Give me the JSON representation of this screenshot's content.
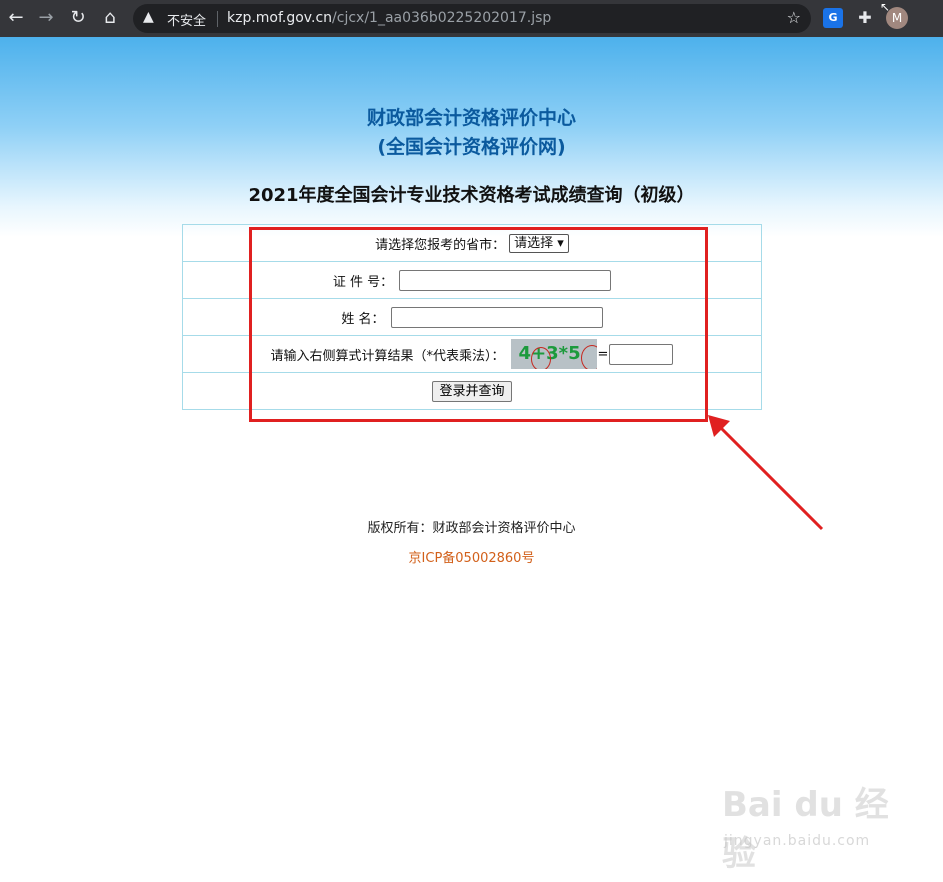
{
  "browser": {
    "back_icon": "←",
    "forward_icon": "→",
    "reload_icon": "↻",
    "home_icon": "⌂",
    "security_icon": "▲",
    "security_label": "不安全",
    "url_host": "kzp.mof.gov.cn",
    "url_path": "/cjcx/1_aa036b0225202017.jsp",
    "star_icon": "☆",
    "translate_ext": "G",
    "puzzle_icon": "✚",
    "avatar_letter": "M"
  },
  "header": {
    "site_name_line1": "财政部会计资格评价中心",
    "site_name_line2": "(全国会计资格评价网)",
    "exam_title": "2021年度全国会计专业技术资格考试成绩查询（初级）"
  },
  "form": {
    "province_label": "请选择您报考的省市：",
    "province_selected": "请选择 ▾",
    "id_label": "证 件 号：",
    "name_label": "姓  名：",
    "captcha_label": "请输入右侧算式计算结果（*代表乘法）：",
    "captcha_text": "4+3*5",
    "equals": "=",
    "submit_label": "登录并查询"
  },
  "footer": {
    "copyright": "版权所有：财政部会计资格评价中心",
    "icp": "京ICP备05002860号"
  },
  "watermark": {
    "brand": "Bai du 经验",
    "sub": "jingyan.baidu.com"
  },
  "colors": {
    "highlight": "#e02020",
    "title_blue": "#0b5a9e",
    "icp_orange": "#d2601a"
  }
}
